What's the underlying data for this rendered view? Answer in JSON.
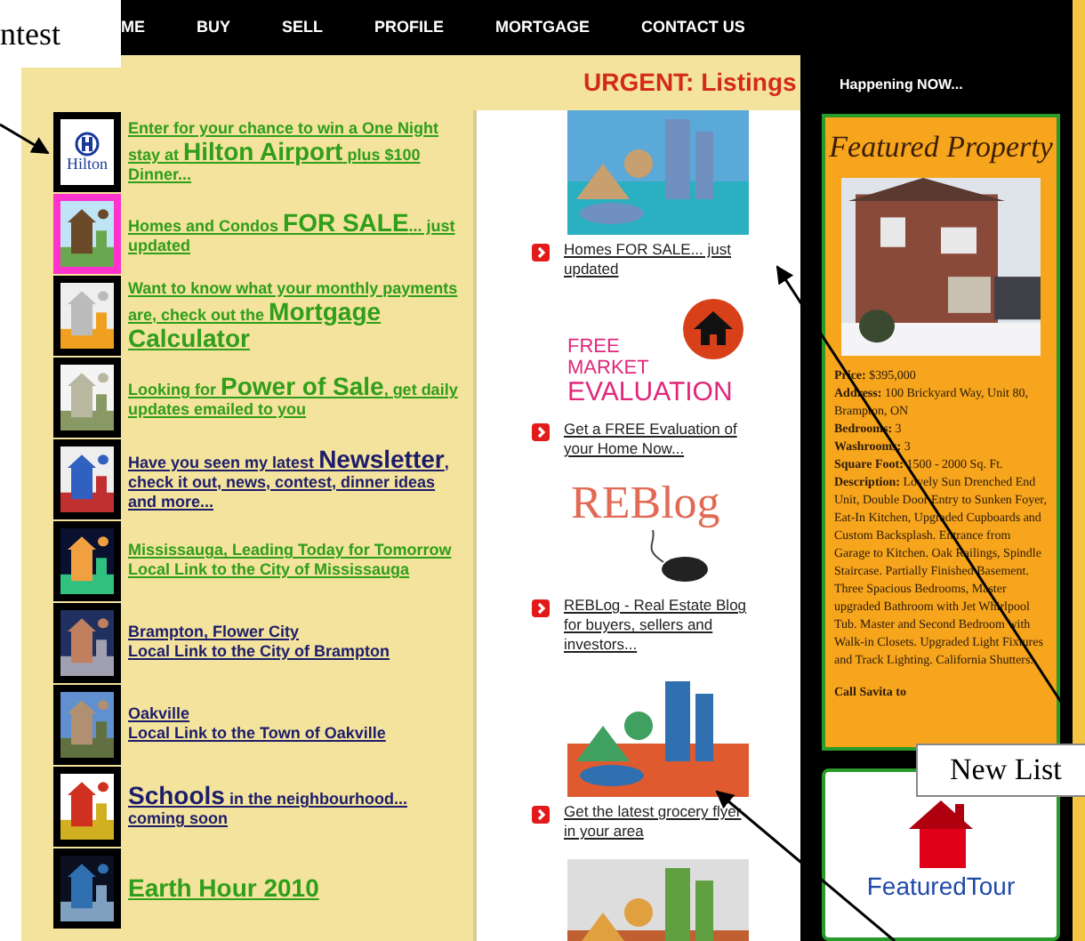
{
  "nav": [
    {
      "label": "ME"
    },
    {
      "label": "BUY"
    },
    {
      "label": "SELL"
    },
    {
      "label": "PROFILE"
    },
    {
      "label": "MORTGAGE"
    },
    {
      "label": "CONTACT US"
    }
  ],
  "urgent": "URGENT: Listings",
  "left_items": [
    {
      "thumb": {
        "kind": "logo",
        "text": "Hilton"
      },
      "highlighted": false,
      "color": "#2f9e1a",
      "links": [
        [
          {
            "text": "Enter for your chance to win a One Night stay at ",
            "big": false
          },
          {
            "text": "Hilton Airport",
            "big": true
          },
          {
            "text": " plus $100 Dinner...",
            "big": false
          }
        ]
      ]
    },
    {
      "thumb": {
        "kind": "picture"
      },
      "highlighted": true,
      "color": "#2f9e1a",
      "links": [
        [
          {
            "text": "Homes and Condos ",
            "big": false
          },
          {
            "text": "FOR SALE",
            "big": true
          },
          {
            "text": "... just updated",
            "big": false
          }
        ]
      ]
    },
    {
      "thumb": {
        "kind": "picture"
      },
      "highlighted": false,
      "color": "#2f9e1a",
      "links": [
        [
          {
            "text": "Want to know what your monthly payments are, check out the ",
            "big": false
          },
          {
            "text": "Mortgage Calculator",
            "big": true
          }
        ]
      ]
    },
    {
      "thumb": {
        "kind": "picture"
      },
      "highlighted": false,
      "color": "#2f9e1a",
      "links": [
        [
          {
            "text": "Looking for ",
            "big": false
          },
          {
            "text": "Power of Sale",
            "big": true
          },
          {
            "text": ", get daily updates emailed to you",
            "big": false
          }
        ]
      ]
    },
    {
      "thumb": {
        "kind": "picture"
      },
      "highlighted": false,
      "color": "#1c1c6b",
      "links": [
        [
          {
            "text": "Have you seen my latest ",
            "big": false
          },
          {
            "text": "Newsletter",
            "big": true
          },
          {
            "text": ", check it out, news, contest, dinner ideas and more...",
            "big": false
          }
        ]
      ]
    },
    {
      "thumb": {
        "kind": "picture"
      },
      "highlighted": false,
      "color": "#2f9e1a",
      "links": [
        [
          {
            "text": "Mississauga, Leading Today for Tomorrow",
            "big": false
          }
        ],
        [
          {
            "text": "Local Link to the City of Mississauga",
            "big": false
          }
        ]
      ]
    },
    {
      "thumb": {
        "kind": "picture"
      },
      "highlighted": false,
      "color": "#1c1c6b",
      "links": [
        [
          {
            "text": "Brampton, Flower City",
            "big": false
          }
        ],
        [
          {
            "text": "Local Link to the City of Brampton",
            "big": false
          }
        ]
      ]
    },
    {
      "thumb": {
        "kind": "picture"
      },
      "highlighted": false,
      "color": "#1c1c6b",
      "links": [
        [
          {
            "text": "Oakville",
            "big": false
          }
        ],
        [
          {
            "text": "Local Link to the Town of Oakville",
            "big": false
          }
        ]
      ]
    },
    {
      "thumb": {
        "kind": "picture"
      },
      "highlighted": false,
      "color": "#1c1c6b",
      "links": [
        [
          {
            "text": "Schools",
            "big": true
          },
          {
            "text": " in the neighbourhood... coming soon",
            "big": false
          }
        ]
      ]
    },
    {
      "thumb": {
        "kind": "picture"
      },
      "highlighted": false,
      "color": "#2f9e1a",
      "links": [
        [
          {
            "text": "Earth Hour 2010",
            "big": true
          }
        ]
      ]
    }
  ],
  "promos": [
    {
      "kind": "picture",
      "link": "Homes FOR SALE... just updated"
    },
    {
      "kind": "evaluation",
      "lines": [
        "FREE",
        "MARKET",
        "EVALUATION"
      ],
      "link": "Get a FREE Evaluation of your Home Now..."
    },
    {
      "kind": "blog",
      "lines": [
        "REBlog"
      ],
      "link": "REBLog - Real Estate Blog for buyers, sellers and investors..."
    },
    {
      "kind": "picture",
      "link": "Get the latest grocery flyer in your area"
    },
    {
      "kind": "picture"
    }
  ],
  "happening": "Happening NOW...",
  "featured": {
    "title": "Featured Property",
    "details": [
      {
        "label": "Price:",
        "value": "$395,000"
      },
      {
        "label": "Address:",
        "value": "100 Brickyard Way, Unit 80, Brampton, ON"
      },
      {
        "label": "Bedrooms:",
        "value": "3"
      },
      {
        "label": "Washrooms:",
        "value": "3"
      },
      {
        "label": "Square Foot:",
        "value": "1500 - 2000 Sq. Ft."
      },
      {
        "label": "Description:",
        "value": "Lovely Sun Drenched End Unit, Double Door Entry to Sunken Foyer, Eat-In Kitchen, Upgraded Cupboards and Custom Backsplash.  Entrance from Garage to Kitchen.  Oak Railings, Spindle Staircase. Partially Finished Basement. Three Spacious Bedrooms, Master upgraded Bathroom with Jet Whirlpool Tub. Master and Second Bedroom with Walk-in Closets. Upgraded Light Fixtures and Track Lighting. California Shutters."
      }
    ],
    "call": "Call Savita to"
  },
  "tour": {
    "text": "FeaturedTour"
  },
  "callouts": [
    {
      "text": "ntest"
    },
    {
      "text": "New List"
    }
  ]
}
